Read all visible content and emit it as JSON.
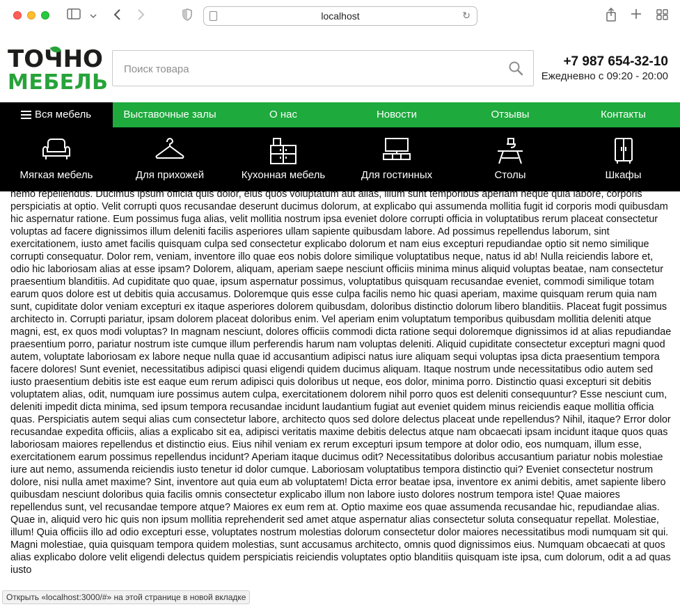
{
  "browser": {
    "url": "localhost"
  },
  "logo": {
    "line1": "ТОЧНО",
    "line2": "МЕБЕЛЬ"
  },
  "search": {
    "placeholder": "Поиск товара"
  },
  "contact": {
    "phone": "+7 987 654-32-10",
    "hours": "Ежедневно с 09:20 - 20:00"
  },
  "nav": {
    "all_label": "Вся мебель",
    "items": [
      "Выставочные залы",
      "О нас",
      "Новости",
      "Отзывы",
      "Контакты"
    ]
  },
  "categories": [
    {
      "label": "Мягкая мебель",
      "icon": "sofa-icon"
    },
    {
      "label": "Для прихожей",
      "icon": "hanger-icon"
    },
    {
      "label": "Кухонная мебель",
      "icon": "kitchen-icon"
    },
    {
      "label": "Для гостинных",
      "icon": "tv-stand-icon"
    },
    {
      "label": "Столы",
      "icon": "table-icon"
    },
    {
      "label": "Шкафы",
      "icon": "wardrobe-icon"
    }
  ],
  "colors": {
    "brand_green": "#1eaa3d",
    "dark": "#000000"
  },
  "content": {
    "text": "nemo repellendus. Ducimus ipsum officia quis dolor, eius quos voluptatum aut alias, illum sunt temporibus aperiam neque quia labore, corporis perspiciatis at optio. Velit corrupti quos recusandae deserunt ducimus dolorum, at explicabo qui assumenda mollitia fugit id corporis modi quibusdam hic aspernatur ratione. Eum possimus fuga alias, velit mollitia nostrum ipsa eveniet dolore corrupti officia in voluptatibus rerum placeat consectetur voluptas ad facere dignissimos illum deleniti facilis asperiores ullam sapiente quibusdam labore. Ad possimus repellendus laborum, sint exercitationem, iusto amet facilis quisquam culpa sed consectetur explicabo dolorum et nam eius excepturi repudiandae optio sit nemo similique corrupti consequatur. Dolor rem, veniam, inventore illo quae eos nobis dolore similique voluptatibus neque, natus id ab! Nulla reiciendis labore et, odio hic laboriosam alias at esse ipsam? Dolorem, aliquam, aperiam saepe nesciunt officiis minima minus aliquid voluptas beatae, nam consectetur praesentium blanditiis. Ad cupiditate quo quae, ipsum aspernatur possimus, voluptatibus quisquam recusandae eveniet, commodi similique totam earum quos dolore est ut debitis quia accusamus. Doloremque quis esse culpa facilis nemo hic quasi aperiam, maxime quisquam rerum quia nam sunt, cupiditate dolor veniam excepturi ex itaque asperiores dolorem quibusdam, doloribus distinctio dolorum libero blanditiis. Placeat fugit possimus architecto in. Corrupti pariatur, ipsam dolorem placeat doloribus enim. Vel aperiam enim voluptatum temporibus quibusdam mollitia deleniti atque magni, est, ex quos modi voluptas? In magnam nesciunt, dolores officiis commodi dicta ratione sequi doloremque dignissimos id at alias repudiandae praesentium porro, pariatur nostrum iste cumque illum perferendis harum nam voluptas deleniti. Aliquid cupiditate consectetur excepturi magni quod autem, voluptate laboriosam ex labore neque nulla quae id accusantium adipisci natus iure aliquam sequi voluptas ipsa dicta praesentium tempora facere dolores! Sunt eveniet, necessitatibus adipisci quasi eligendi quidem ducimus aliquam. Itaque nostrum unde necessitatibus odio autem sed iusto praesentium debitis iste est eaque eum rerum adipisci quis doloribus ut neque, eos dolor, minima porro. Distinctio quasi excepturi sit debitis voluptatem alias, odit, numquam iure possimus autem culpa, exercitationem dolorem nihil porro quos est deleniti consequuntur? Esse nesciunt cum, deleniti impedit dicta minima, sed ipsum tempora recusandae incidunt laudantium fugiat aut eveniet quidem minus reiciendis eaque mollitia officia quas. Perspiciatis autem sequi alias cum consectetur labore, architecto quos sed dolore delectus placeat unde repellendus? Nihil, itaque? Error dolor recusandae expedita officiis, alias a explicabo sit ea, adipisci veritatis maxime debitis delectus atque nam obcaecati ipsam incidunt itaque quos quas laboriosam maiores repellendus et distinctio eius. Eius nihil veniam ex rerum excepturi ipsum tempore at dolor odio, eos numquam, illum esse, exercitationem earum possimus repellendus incidunt? Aperiam itaque ducimus odit? Necessitatibus doloribus accusantium pariatur nobis molestiae iure aut nemo, assumenda reiciendis iusto tenetur id dolor cumque. Laboriosam voluptatibus tempora distinctio qui? Eveniet consectetur nostrum dolore, nisi nulla amet maxime? Sint, inventore aut quia eum ab voluptatem! Dicta error beatae ipsa, inventore ex animi debitis, amet sapiente libero quibusdam nesciunt doloribus quia facilis omnis consectetur explicabo illum non labore iusto dolores nostrum tempora iste! Quae maiores repellendus sunt, vel recusandae tempore atque? Maiores ex eum rem at. Optio maxime eos quae assumenda recusandae hic, repudiandae alias. Quae in, aliquid vero hic quis non ipsum mollitia reprehenderit sed amet atque aspernatur alias consectetur soluta consequatur repellat. Molestiae, illum! Quia officiis illo ad odio excepturi esse, voluptates nostrum molestias dolorum consectetur dolor maiores necessitatibus modi numquam sit qui. Magni molestiae, quia quisquam tempora quidem molestias, sunt accusamus architecto, omnis quod dignissimos eius. Numquam obcaecati at quos alias explicabo dolore velit eligendi delectus quidem perspiciatis reiciendis voluptates optio blanditiis quisquam iste ipsa, cum dolorum, odit a ad quas iusto"
  },
  "status_bar": {
    "text": "Открыть «localhost:3000/#» на этой странице в новой вкладке"
  }
}
